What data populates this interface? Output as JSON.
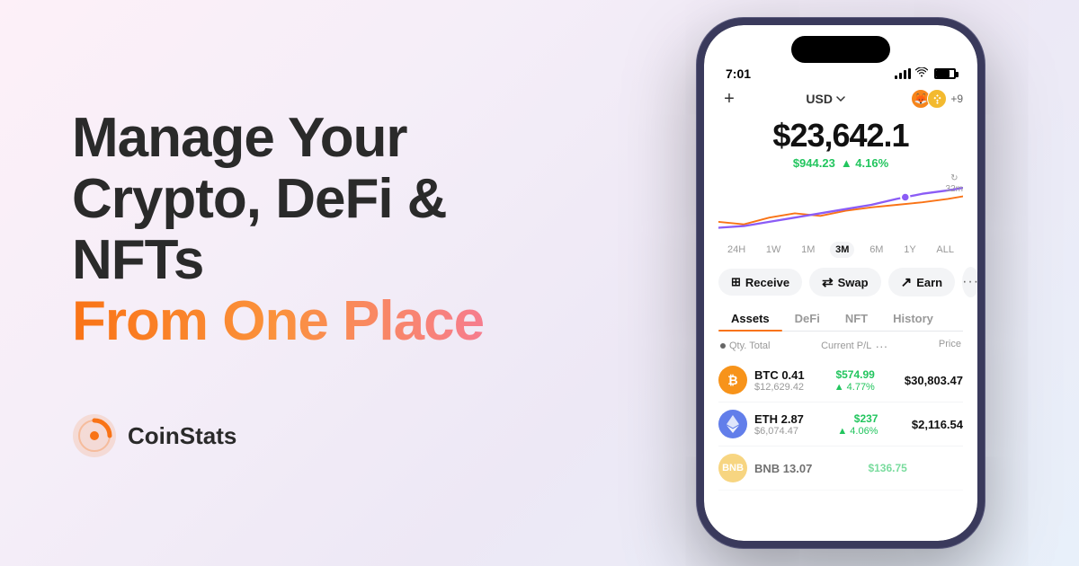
{
  "meta": {
    "bg_gradient_start": "#fdf0f8",
    "bg_gradient_end": "#e8f0fa"
  },
  "headline": {
    "line1": "Manage Your",
    "line2": "Crypto, DeFi & NFTs",
    "line3_orange": "From One Place"
  },
  "brand": {
    "name": "CoinStats",
    "logo_alt": "CoinStats logo"
  },
  "phone": {
    "status_bar": {
      "time": "7:01",
      "signal": "signal",
      "wifi": "wifi",
      "battery": "battery"
    },
    "top_bar": {
      "add_symbol": "+",
      "currency": "USD",
      "wallet_count": "+9"
    },
    "balance": {
      "amount": "$23,642.1",
      "change_amount": "$944.23",
      "change_percent": "▲ 4.16%"
    },
    "refresh": {
      "symbol": "↻",
      "time": "32m"
    },
    "time_filters": [
      "24H",
      "1W",
      "1M",
      "3M",
      "6M",
      "1Y",
      "ALL"
    ],
    "active_filter": "3M",
    "action_buttons": [
      {
        "id": "receive",
        "icon": "⊞",
        "label": "Receive"
      },
      {
        "id": "swap",
        "icon": "⇄",
        "label": "Swap"
      },
      {
        "id": "earn",
        "icon": "↗",
        "label": "Earn"
      }
    ],
    "tabs": [
      "Assets",
      "DeFi",
      "NFT",
      "History"
    ],
    "active_tab": "Assets",
    "assets_header": {
      "indicator": "•",
      "qty_total": "Qty. Total",
      "current_pl": "Current P/L",
      "more": "...",
      "price": "Price"
    },
    "assets": [
      {
        "symbol": "BTC",
        "qty": "0.41",
        "value": "$12,629.42",
        "pnl_amount": "$574.99",
        "pnl_percent": "▲ 4.77%",
        "price": "$30,803.47",
        "icon_color": "#f7931a",
        "icon_label": "₿"
      },
      {
        "symbol": "ETH",
        "qty": "2.87",
        "value": "$6,074.47",
        "pnl_amount": "$237",
        "pnl_percent": "▲ 4.06%",
        "price": "$2,116.54",
        "icon_color": "#627eea",
        "icon_label": "Ξ"
      },
      {
        "symbol": "BNB",
        "qty": "13.07",
        "value": "",
        "pnl_amount": "$136.75",
        "pnl_percent": "",
        "price": "",
        "icon_color": "#f3ba2f",
        "icon_label": "B"
      }
    ]
  }
}
